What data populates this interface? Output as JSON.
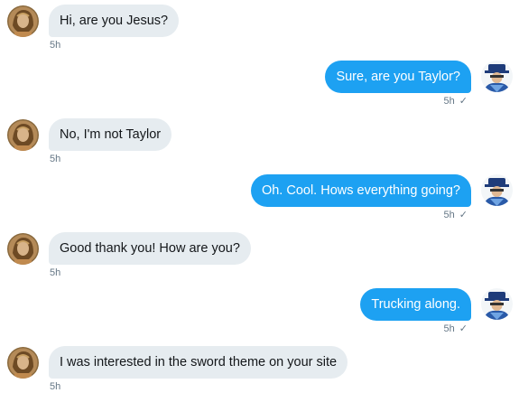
{
  "conversation": {
    "messages": [
      {
        "direction": "incoming",
        "text": "Hi, are you Jesus?",
        "time": "5h"
      },
      {
        "direction": "outgoing",
        "text": "Sure, are you Taylor?",
        "time": "5h",
        "seen_icon": "checkmark-icon"
      },
      {
        "direction": "incoming",
        "text": "No, I'm not Taylor",
        "time": "5h"
      },
      {
        "direction": "outgoing",
        "text": "Oh. Cool. Hows everything going?",
        "time": "5h",
        "seen_icon": "checkmark-icon"
      },
      {
        "direction": "incoming",
        "text": "Good thank you! How are you?",
        "time": "5h"
      },
      {
        "direction": "outgoing",
        "text": "Trucking along.",
        "time": "5h",
        "seen_icon": "checkmark-icon"
      },
      {
        "direction": "incoming",
        "text": "I was interested in the sword theme on your site",
        "time": "5h"
      }
    ]
  },
  "colors": {
    "outgoing_bubble": "#1da1f2",
    "incoming_bubble": "#e6ecf0",
    "meta_text": "#657786"
  },
  "check_glyph": "✓"
}
